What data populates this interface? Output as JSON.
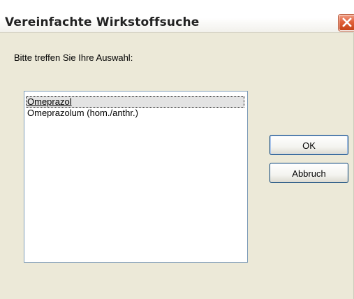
{
  "window": {
    "title": "Vereinfachte Wirkstoffsuche"
  },
  "dialog": {
    "prompt": "Bitte treffen Sie Ihre Auswahl:",
    "list_items": [
      {
        "label": "Omeprazol",
        "selected": true
      },
      {
        "label": "Omeprazolum (hom./anthr.)",
        "selected": false
      }
    ],
    "ok_label": "OK",
    "cancel_label": "Abbruch"
  },
  "icons": {
    "close": "close-icon"
  },
  "colors": {
    "dialog_background": "#ece9d8",
    "close_button": "#e0603a",
    "list_border": "#7f9db9",
    "button_border": "#003c74"
  }
}
